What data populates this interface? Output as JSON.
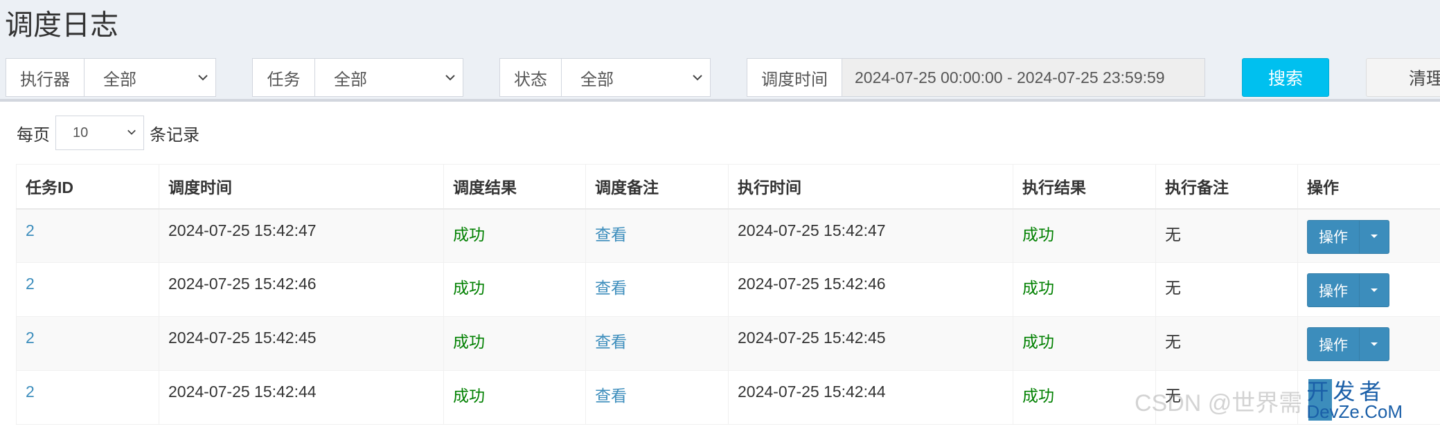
{
  "page_title": "调度日志",
  "filters": {
    "executor": {
      "label": "执行器",
      "value": "全部"
    },
    "task": {
      "label": "任务",
      "value": "全部"
    },
    "status": {
      "label": "状态",
      "value": "全部"
    },
    "time": {
      "label": "调度时间",
      "value": "2024-07-25 00:00:00 - 2024-07-25 23:59:59"
    },
    "search_label": "搜索",
    "clear_label": "清理"
  },
  "per_page": {
    "prefix": "每页",
    "value": "10",
    "suffix": "条记录"
  },
  "table": {
    "columns": [
      "任务ID",
      "调度时间",
      "调度结果",
      "调度备注",
      "执行时间",
      "执行结果",
      "执行备注",
      "操作"
    ],
    "rows": [
      {
        "id": "2",
        "trigger_time": "2024-07-25 15:42:47",
        "trigger_result": "成功",
        "trigger_note": "查看",
        "exec_time": "2024-07-25 15:42:47",
        "exec_result": "成功",
        "exec_note": "无",
        "action": "操作"
      },
      {
        "id": "2",
        "trigger_time": "2024-07-25 15:42:46",
        "trigger_result": "成功",
        "trigger_note": "查看",
        "exec_time": "2024-07-25 15:42:46",
        "exec_result": "成功",
        "exec_note": "无",
        "action": "操作"
      },
      {
        "id": "2",
        "trigger_time": "2024-07-25 15:42:45",
        "trigger_result": "成功",
        "trigger_note": "查看",
        "exec_time": "2024-07-25 15:42:45",
        "exec_result": "成功",
        "exec_note": "无",
        "action": "操作"
      },
      {
        "id": "2",
        "trigger_time": "2024-07-25 15:42:44",
        "trigger_result": "成功",
        "trigger_note": "查看",
        "exec_time": "2024-07-25 15:42:44",
        "exec_result": "成功",
        "exec_note": "无",
        "action": "操作"
      }
    ]
  },
  "watermark": {
    "text": "CSDN @世界需",
    "logo_top": "开发者",
    "logo_bottom": "DevZe.CoM"
  },
  "colors": {
    "accent": "#00c0ef",
    "link": "#3c8dbc",
    "success": "#008000",
    "primary_button": "#3c8dbc"
  }
}
